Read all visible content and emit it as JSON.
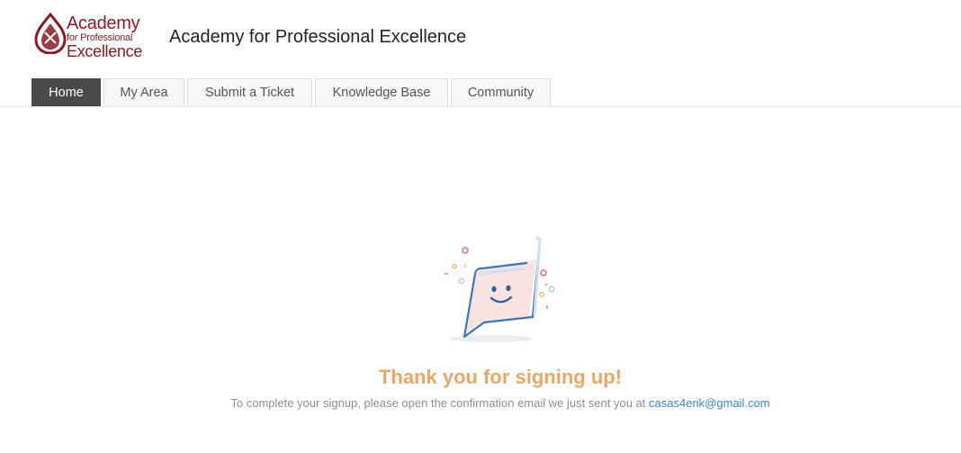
{
  "header": {
    "logo": {
      "line1": "Academy",
      "line2": "for Professional",
      "line3": "Excellence"
    },
    "site_title": "Academy for Professional Excellence"
  },
  "tabs": [
    {
      "label": "Home",
      "active": true
    },
    {
      "label": "My Area",
      "active": false
    },
    {
      "label": "Submit a Ticket",
      "active": false
    },
    {
      "label": "Knowledge Base",
      "active": false
    },
    {
      "label": "Community",
      "active": false
    }
  ],
  "confirmation": {
    "heading": "Thank you for signing up!",
    "message": "To complete your signup, please open the confirmation email we just sent you at",
    "email": "casas4erik@gmail.com"
  },
  "colors": {
    "brand": "#8b1a24",
    "active_tab": "#4a4a4a",
    "heading": "#e8a865",
    "link": "#3a87c4"
  },
  "icons": [
    "academy-logo-icon",
    "smiling-chat-bubble-illustration"
  ]
}
